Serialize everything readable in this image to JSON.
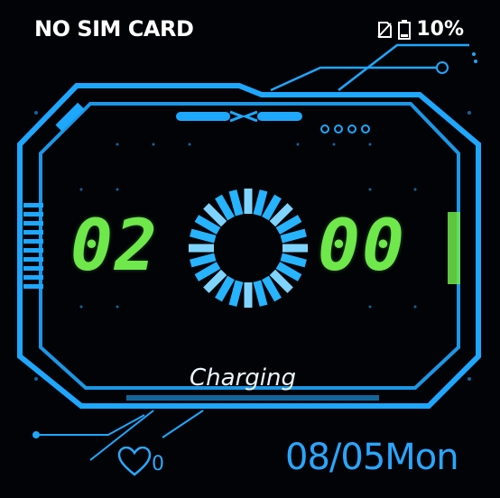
{
  "status_bar": {
    "network": "NO SIM CARD",
    "battery": "10%"
  },
  "clock": {
    "hours": "02",
    "minutes": "00"
  },
  "charge": {
    "label": "Charging"
  },
  "footer": {
    "heart_count": "0",
    "date": "08/05Mon"
  },
  "colors": {
    "frame": "#1ea7ff",
    "digits": "#6ee84a",
    "date": "#29a6ff"
  },
  "icons": [
    "no-sim-icon",
    "battery-icon",
    "heart-icon",
    "charging-ring-icon"
  ]
}
